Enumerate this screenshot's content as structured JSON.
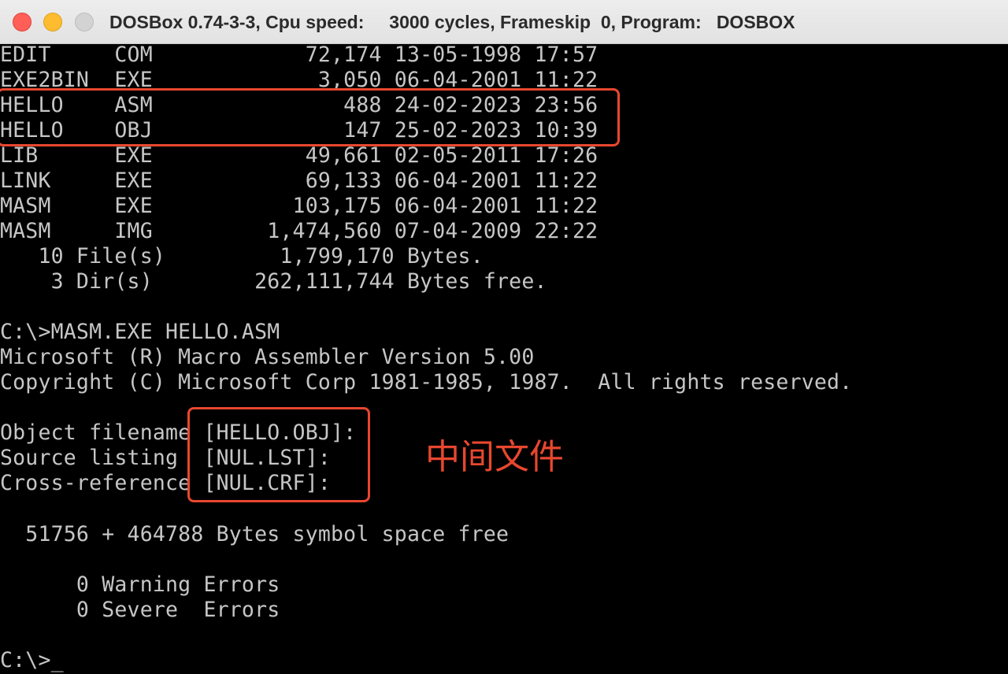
{
  "window": {
    "title": "DOSBox 0.74-3-3, Cpu speed:     3000 cycles, Frameskip  0, Program:   DOSBOX"
  },
  "terminal": {
    "lines": [
      "EDIT     COM            72,174 13-05-1998 17:57",
      "EXE2BIN  EXE             3,050 06-04-2001 11:22",
      "HELLO    ASM               488 24-02-2023 23:56",
      "HELLO    OBJ               147 25-02-2023 10:39",
      "LIB      EXE            49,661 02-05-2011 17:26",
      "LINK     EXE            69,133 06-04-2001 11:22",
      "MASM     EXE           103,175 06-04-2001 11:22",
      "MASM     IMG         1,474,560 07-04-2009 22:22",
      "   10 File(s)         1,799,170 Bytes.",
      "    3 Dir(s)        262,111,744 Bytes free.",
      "",
      "C:\\>MASM.EXE HELLO.ASM",
      "Microsoft (R) Macro Assembler Version 5.00",
      "Copyright (C) Microsoft Corp 1981-1985, 1987.  All rights reserved.",
      "",
      "Object filename [HELLO.OBJ]:",
      "Source listing  [NUL.LST]:",
      "Cross-reference [NUL.CRF]:",
      "",
      "  51756 + 464788 Bytes symbol space free",
      "",
      "      0 Warning Errors",
      "      0 Severe  Errors",
      "",
      "C:\\>_"
    ]
  },
  "annotations": {
    "label": "中间文件",
    "color": "#e8472f"
  }
}
